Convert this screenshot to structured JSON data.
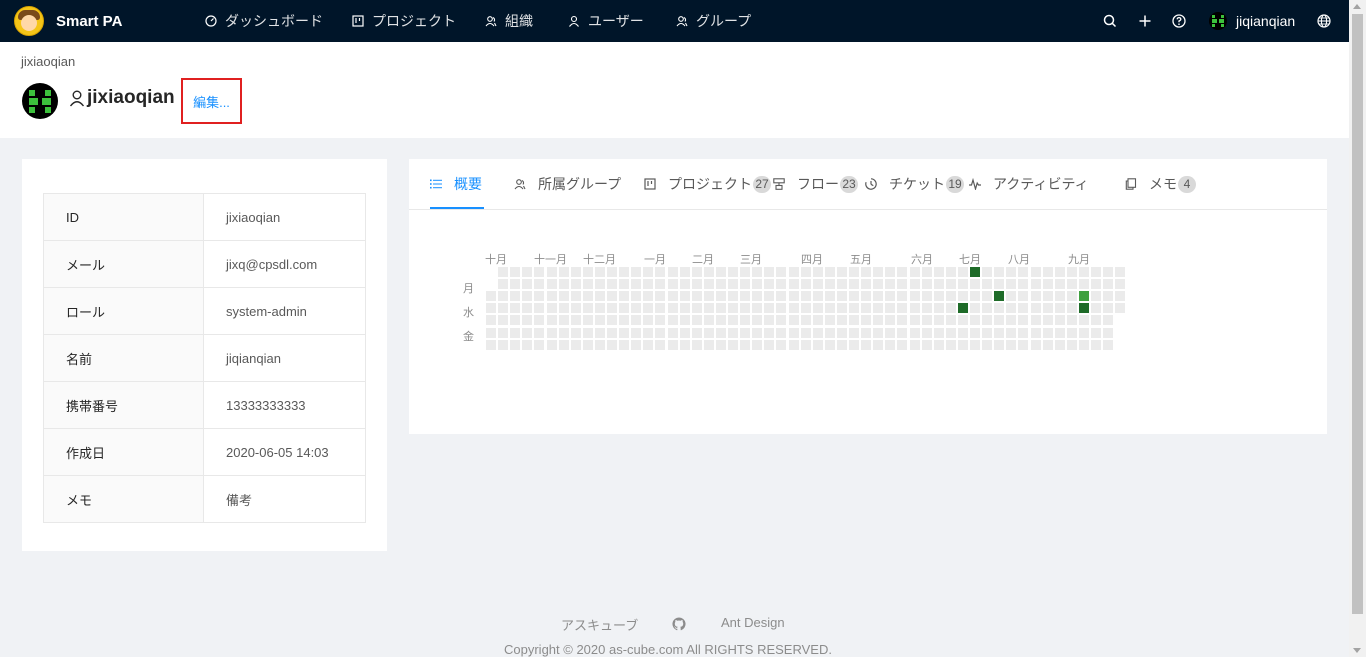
{
  "app": {
    "name": "Smart PA"
  },
  "nav": {
    "items": [
      {
        "label": "ダッシュボード",
        "icon": "dashboard-icon"
      },
      {
        "label": "プロジェクト",
        "icon": "project-icon"
      },
      {
        "label": "組織",
        "icon": "team-icon"
      },
      {
        "label": "ユーザー",
        "icon": "user-icon"
      },
      {
        "label": "グループ",
        "icon": "group-icon"
      }
    ],
    "user": "jiqianqian"
  },
  "header": {
    "breadcrumb": "jixiaoqian",
    "title": "jixiaoqian",
    "edit": "編集..."
  },
  "profile": {
    "rows": [
      {
        "key": "ID",
        "value": "jixiaoqian"
      },
      {
        "key": "メール",
        "value": "jixq@cpsdl.com"
      },
      {
        "key": "ロール",
        "value": "system-admin"
      },
      {
        "key": "名前",
        "value": "jiqianqian"
      },
      {
        "key": "携帯番号",
        "value": "13333333333"
      },
      {
        "key": "作成日",
        "value": "2020-06-05 14:03"
      },
      {
        "key": "メモ",
        "value": "備考"
      }
    ]
  },
  "tabs": [
    {
      "label": "概要",
      "count": ""
    },
    {
      "label": "所属グループ",
      "count": ""
    },
    {
      "label": "プロジェクト",
      "count": "27"
    },
    {
      "label": "フロー",
      "count": "23"
    },
    {
      "label": "チケット",
      "count": "19"
    },
    {
      "label": "アクティビティ",
      "count": ""
    },
    {
      "label": "メモ",
      "count": "4"
    }
  ],
  "activity": {
    "months": [
      "十月",
      "十一月",
      "十二月",
      "一月",
      "二月",
      "三月",
      "四月",
      "五月",
      "六月",
      "七月",
      "八月",
      "九月"
    ],
    "days": [
      "月",
      "水",
      "金"
    ],
    "colors": {
      "empty": "#ebebeb",
      "level1": "#40a040",
      "level2": "#1e6b28"
    }
  },
  "footer": {
    "links": [
      "アスキューブ",
      "Ant Design"
    ],
    "copyright": "Copyright © 2020 as-cube.com All RIGHTS RESERVED."
  }
}
